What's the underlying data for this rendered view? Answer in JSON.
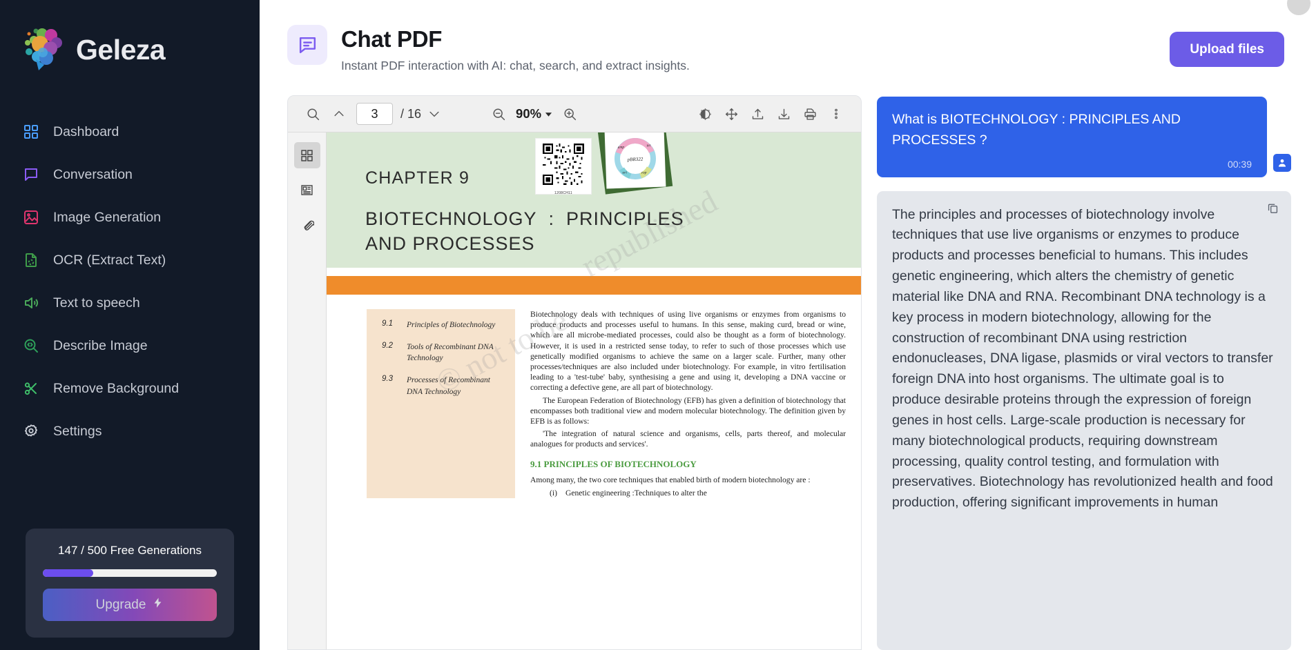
{
  "sidebar": {
    "brand": "Geleza",
    "items": [
      {
        "label": "Dashboard",
        "icon": "grid-icon",
        "color": "#4a9eff"
      },
      {
        "label": "Conversation",
        "icon": "chat-bubble-icon",
        "color": "#8b5cf6"
      },
      {
        "label": "Image Generation",
        "icon": "image-icon",
        "color": "#e0356e"
      },
      {
        "label": "OCR (Extract Text)",
        "icon": "document-scan-icon",
        "color": "#3f9d4a"
      },
      {
        "label": "Text to speech",
        "icon": "speaker-icon",
        "color": "#4aa85a"
      },
      {
        "label": "Describe Image",
        "icon": "magnifier-code-icon",
        "color": "#2ea05a"
      },
      {
        "label": "Remove Background",
        "icon": "scissors-icon",
        "color": "#3fbf6a"
      },
      {
        "label": "Settings",
        "icon": "gear-icon",
        "color": "#c7cbd4"
      }
    ],
    "upgrade": {
      "usage_text": "147 / 500 Free Generations",
      "used": 147,
      "total": 500,
      "progress_percent": 29,
      "button_label": "Upgrade",
      "button_icon": "lightning-bolt-icon",
      "accent": "#6c4dee"
    }
  },
  "header": {
    "icon": "chat-pdf-icon",
    "title": "Chat PDF",
    "subtitle": "Instant PDF interaction with AI: chat, search, and extract insights.",
    "upload_label": "Upload files",
    "upload_color": "#6c5ce7"
  },
  "pdf_viewer": {
    "toolbar": {
      "search_icon": "search-icon",
      "prev_icon": "chevron-up-icon",
      "next_icon": "chevron-down-icon",
      "current_page": "3",
      "page_total": "/ 16",
      "zoom_out_icon": "zoom-out-icon",
      "zoom_value": "90%",
      "zoom_dropdown_icon": "caret-down-icon",
      "zoom_in_icon": "zoom-in-icon",
      "theme_icon": "contrast-icon",
      "pan_icon": "move-icon",
      "upload_icon": "upload-icon",
      "download_icon": "download-icon",
      "print_icon": "print-icon",
      "more_icon": "more-vertical-icon"
    },
    "rail": [
      {
        "icon": "thumbnails-icon",
        "active": true
      },
      {
        "icon": "outline-icon",
        "active": false
      },
      {
        "icon": "attachment-icon",
        "active": false
      }
    ],
    "page": {
      "chapter": "CHAPTER 9",
      "title": "BIOTECHNOLOGY :  PRINCIPLES\nAND PROCESSES",
      "qr_caption": "1208CH11",
      "plasmid_labels": [
        "amp^r",
        "tet^r",
        "pBR322",
        "ori",
        "rop"
      ],
      "watermark": "© not to be republished",
      "toc": [
        {
          "num": "9.1",
          "text": "Principles of Biotechnology"
        },
        {
          "num": "9.2",
          "text": "Tools of Recombinant DNA Technology"
        },
        {
          "num": "9.3",
          "text": "Processes of Recombinant DNA Technology"
        }
      ],
      "paragraphs": [
        "Biotechnology deals with techniques of using live organisms or enzymes from organisms to produce products and processes useful to humans. In this sense, making curd, bread or wine, which are all microbe-mediated processes, could also be thought as a form of biotechnology. However, it is used in a restricted sense today, to refer to such of those processes which use genetically modified organisms to achieve the same on a larger scale. Further, many other processes/techniques are also included under biotechnology. For example, in vitro fertilisation leading to a 'test-tube' baby, synthesising a gene and using it, developing a DNA vaccine or correcting a defective gene, are all part of biotechnology.",
        "The European Federation of Biotechnology (EFB) has given a definition of biotechnology that encompasses both traditional view and modern molecular biotechnology. The definition given by EFB is as follows:",
        "'The integration of natural science and organisms, cells, parts thereof, and molecular analogues for products and services'."
      ],
      "section_heading": "9.1 PRINCIPLES OF BIOTECHNOLOGY",
      "after_heading": "Among many, the two core techniques that enabled birth of modern biotechnology are :",
      "list_marker": "(i)",
      "list_item": "Genetic engineering :Techniques to alter the"
    }
  },
  "chat": {
    "user_message": {
      "text": "What is BIOTECHNOLOGY : PRINCIPLES AND PROCESSES ?",
      "time": "00:39",
      "avatar_icon": "user-avatar-icon",
      "color": "#2f62e8"
    },
    "bot_message": {
      "text": "The principles and processes of biotechnology involve techniques that use live organisms or enzymes to produce products and processes beneficial to humans. This includes genetic engineering, which alters the chemistry of genetic material like DNA and RNA. Recombinant DNA technology is a key process in modern biotechnology, allowing for the construction of recombinant DNA using restriction endonucleases, DNA ligase, plasmids or viral vectors to transfer foreign DNA into host organisms. The ultimate goal is to produce desirable proteins through the expression of foreign genes in host cells. Large-scale production is necessary for many biotechnological products, requiring downstream processing, quality control testing, and formulation with preservatives. Biotechnology has revolutionized health and food production, offering significant improvements in human",
      "copy_icon": "copy-icon",
      "color": "#e4e7ec"
    }
  }
}
